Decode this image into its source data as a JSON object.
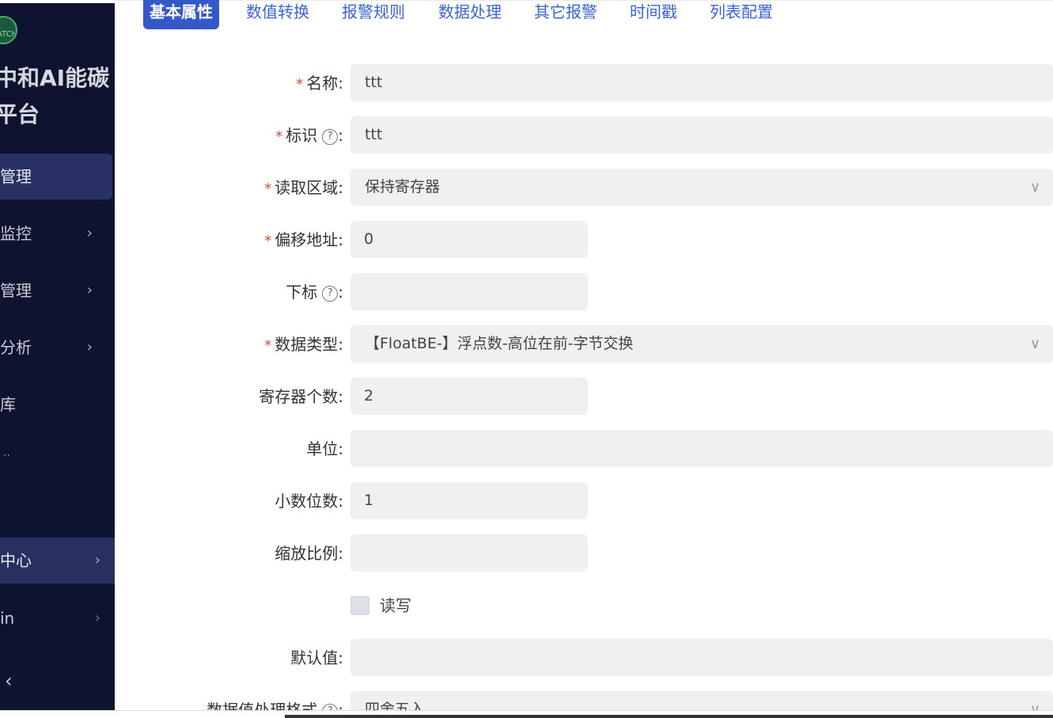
{
  "sidebar": {
    "logo_text": "ATCH 亿达",
    "brand_line1": "中和AI能碳",
    "brand_line2": "平台",
    "items": [
      {
        "label": "管理",
        "chevron": ""
      },
      {
        "label": "监控",
        "chevron": "›"
      },
      {
        "label": "管理",
        "chevron": "›"
      },
      {
        "label": "分析",
        "chevron": "›"
      },
      {
        "label": "库",
        "chevron": ""
      },
      {
        "label": "中心",
        "chevron": "›"
      },
      {
        "label": "in",
        "chevron": "›"
      }
    ],
    "dots": "..",
    "collapse_icon": "‹"
  },
  "tabs": [
    {
      "label": "基本属性"
    },
    {
      "label": "数值转换"
    },
    {
      "label": "报警规则"
    },
    {
      "label": "数据处理"
    },
    {
      "label": "其它报警"
    },
    {
      "label": "时间戳"
    },
    {
      "label": "列表配置"
    }
  ],
  "form": {
    "name": {
      "label": "名称:",
      "value": "ttt",
      "required": "*"
    },
    "identifier": {
      "label": "标识",
      "help": "?",
      "colon": ":",
      "value": "ttt",
      "required": "*"
    },
    "read_area": {
      "label": "读取区域:",
      "value": "保持寄存器",
      "required": "*",
      "caret": "∨"
    },
    "offset": {
      "label": "偏移地址:",
      "value": "0",
      "required": "*"
    },
    "subscript": {
      "label": "下标",
      "help": "?",
      "colon": ":",
      "value": ""
    },
    "data_type": {
      "label": "数据类型:",
      "value": "【FloatBE-】浮点数-高位在前-字节交换",
      "required": "*",
      "caret": "∨"
    },
    "register_count": {
      "label": "寄存器个数:",
      "value": "2"
    },
    "unit": {
      "label": "单位:",
      "value": ""
    },
    "decimals": {
      "label": "小数位数:",
      "value": "1"
    },
    "scale": {
      "label": "缩放比例:",
      "value": ""
    },
    "read_write": {
      "label": "读写"
    },
    "default_value": {
      "label": "默认值:",
      "value": ""
    },
    "value_format": {
      "label": "数据值处理格式",
      "help": "?",
      "colon": ":",
      "value": "四舍五入",
      "caret": "∨"
    }
  }
}
